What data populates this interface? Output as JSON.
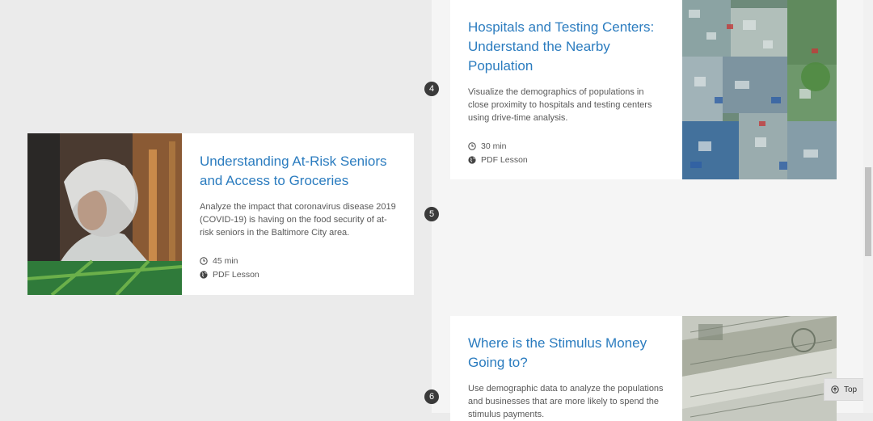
{
  "cards": [
    {
      "step": "4",
      "title": "Hospitals and Testing Centers: Understand the Nearby Population",
      "description": "Visualize the demographics of populations in close proximity to hospitals and testing centers using drive-time analysis.",
      "duration": "30 min",
      "type": "PDF Lesson",
      "image": "aerial-city-photo"
    },
    {
      "step": "5",
      "title": "Understanding At-Risk Seniors and Access to Groceries",
      "description": "Analyze the impact that coronavirus disease 2019 (COVID-19) is having on the food security of at-risk seniors in the Baltimore City area.",
      "duration": "45 min",
      "type": "PDF Lesson",
      "image": "senior-man-photo"
    },
    {
      "step": "6",
      "title": "Where is the Stimulus Money Going to?",
      "description": "Use demographic data to analyze the populations and businesses that are more likely to spend the stimulus payments.",
      "image": "dollar-bill-photo"
    }
  ],
  "top_button": {
    "label": "Top",
    "icon": "arrow-up-circle-icon"
  },
  "icons": {
    "duration": "clock-icon",
    "type": "globe-icon"
  },
  "colors": {
    "title": "#2b7cbf",
    "badge": "#3a3a3a"
  }
}
